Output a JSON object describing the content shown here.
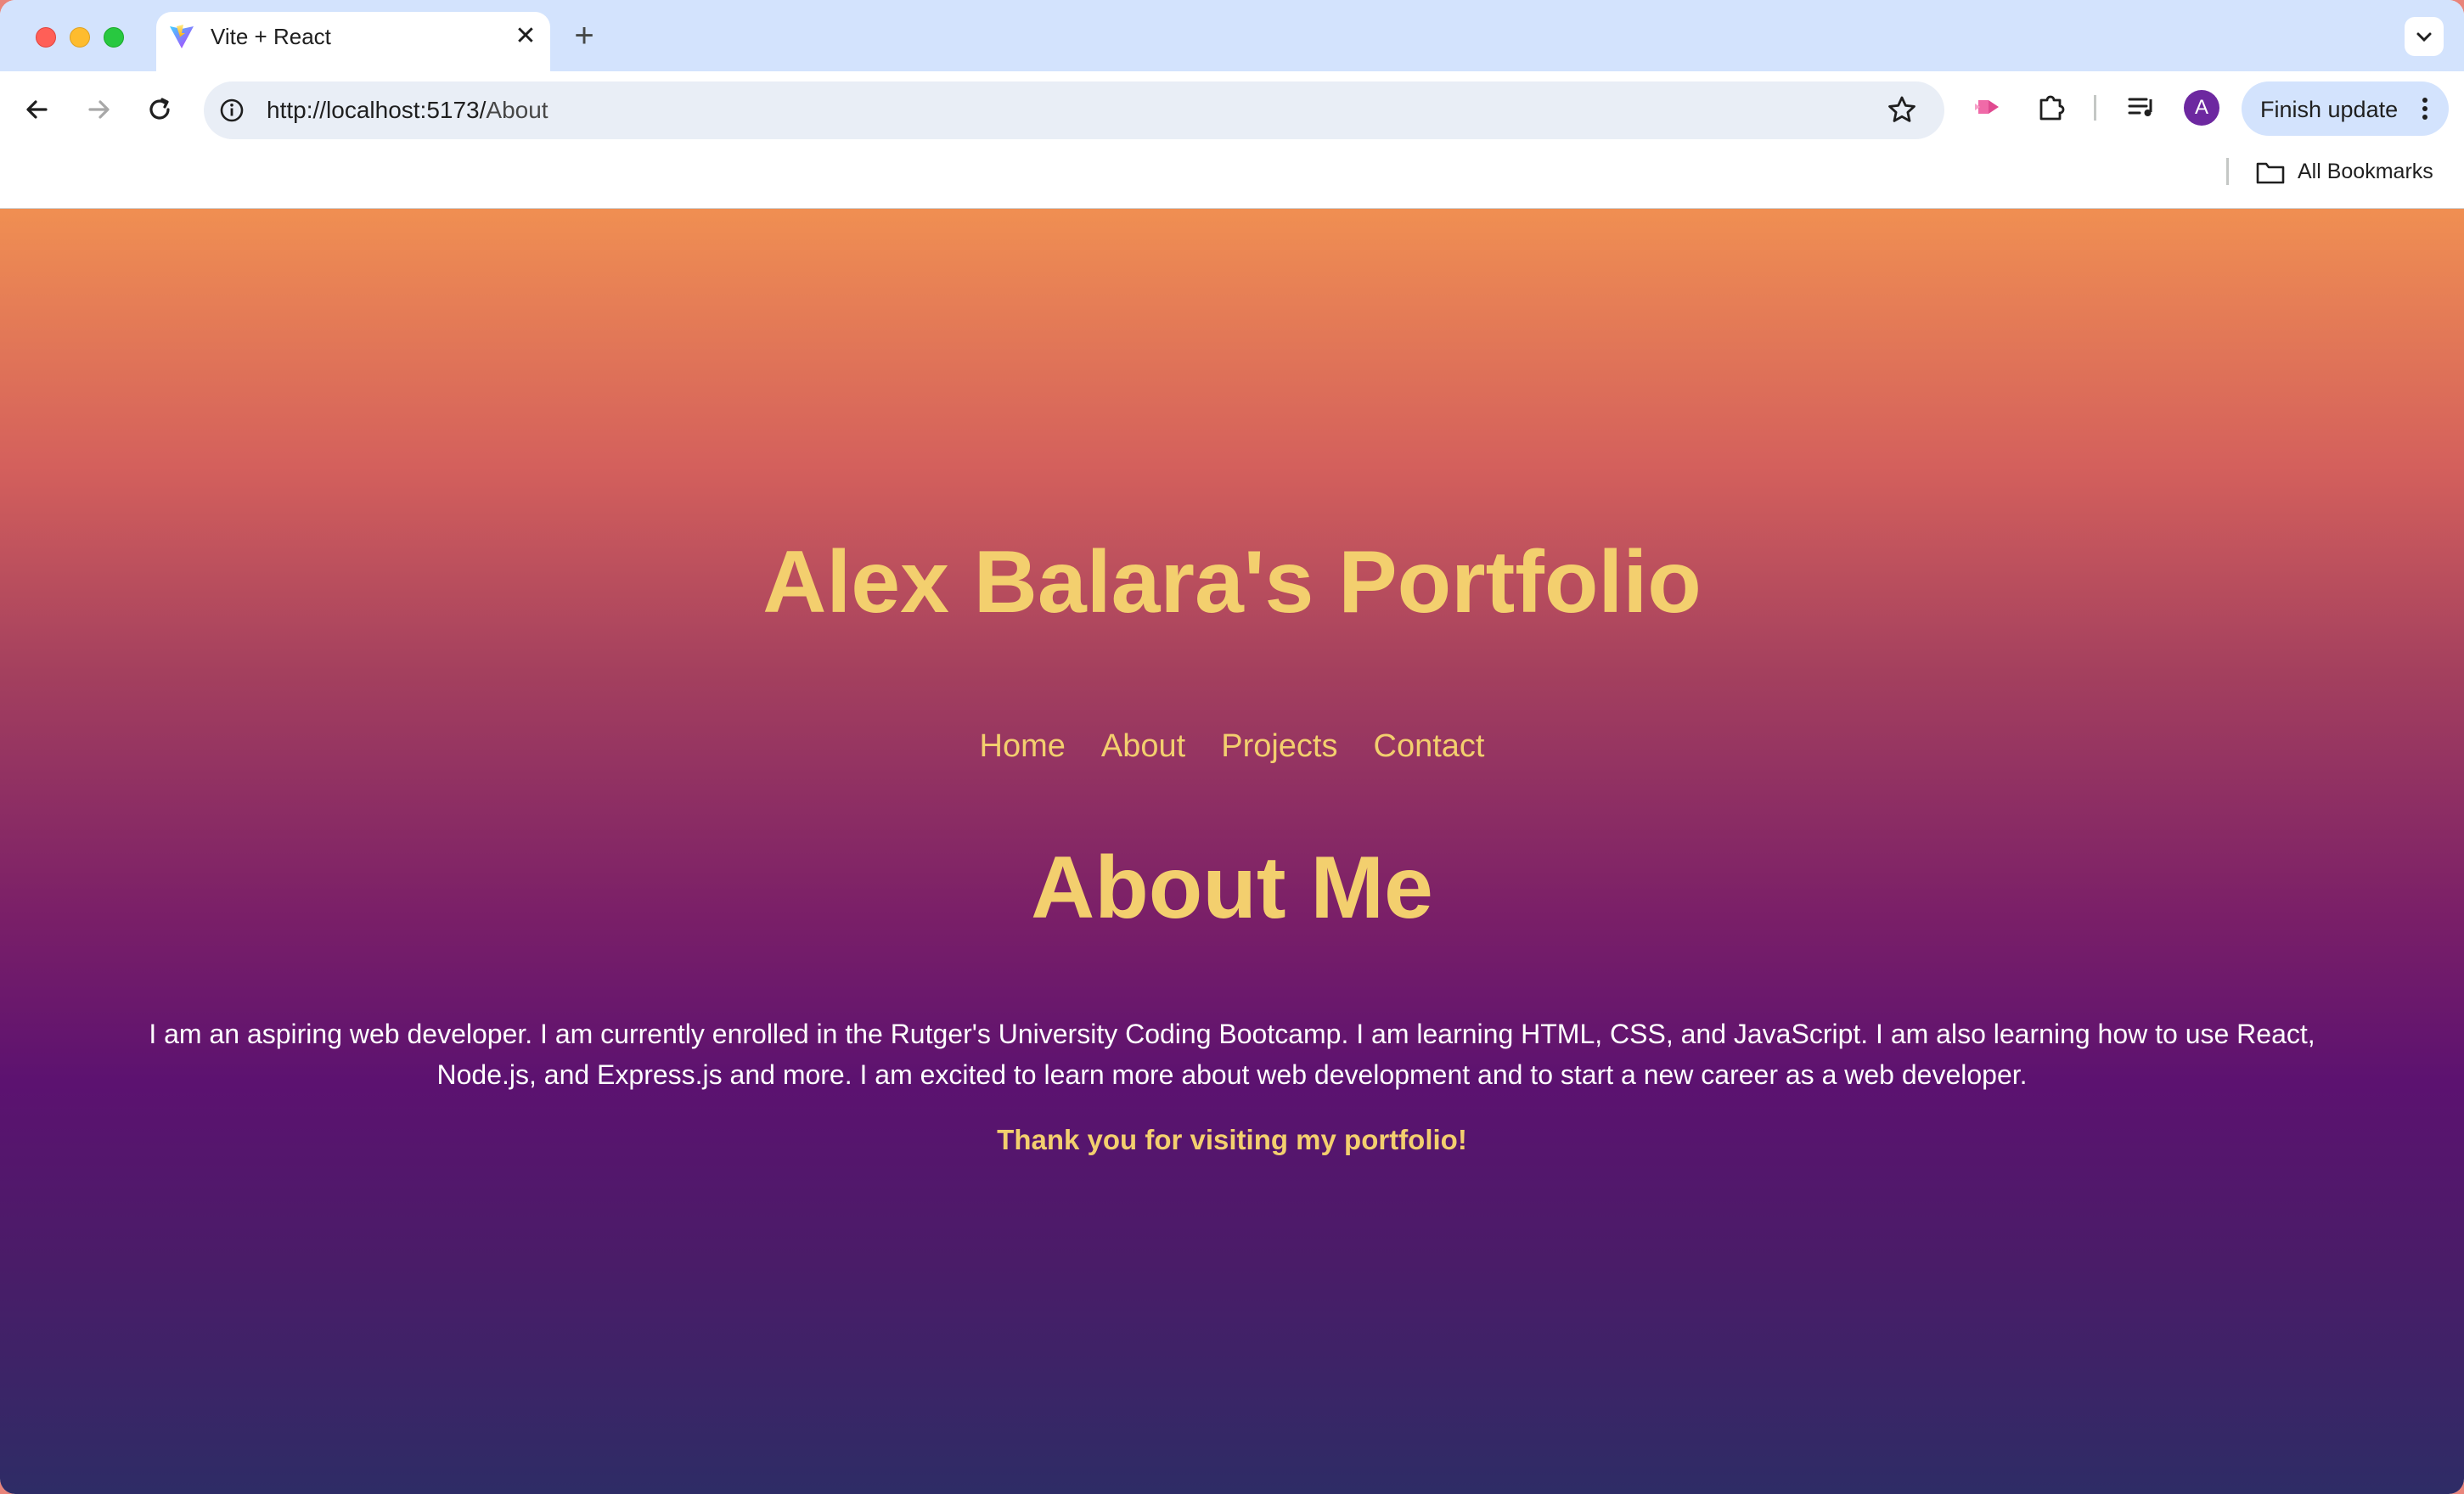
{
  "browser": {
    "tab": {
      "title": "Vite + React",
      "close_glyph": "✕"
    },
    "new_tab_glyph": "+",
    "address_bar": {
      "url_host": "http://localhost:5173/",
      "url_path": "About"
    },
    "profile_initial": "A",
    "finish_update_label": "Finish update",
    "bookmarks": {
      "all_bookmarks_label": "All Bookmarks"
    }
  },
  "site": {
    "title": "Alex Balara's Portfolio",
    "nav": [
      "Home",
      "About",
      "Projects",
      "Contact"
    ]
  },
  "about": {
    "heading": "About Me",
    "paragraph": "I am an aspiring web developer. I am currently enrolled in the Rutger's University Coding Bootcamp. I am learning HTML, CSS, and JavaScript. I am also learning how to use React, Node.js, and Express.js and more. I am excited to learn more about web development and to start a new career as a web developer.",
    "thanks": "Thank you for visiting my portfolio!"
  },
  "colors": {
    "accent_gold": "#f3cf6e",
    "gradient_top": "#f08f52",
    "gradient_mid": "#5c1270",
    "gradient_bottom": "#2e2c66",
    "profile_avatar": "#6d28a0"
  }
}
